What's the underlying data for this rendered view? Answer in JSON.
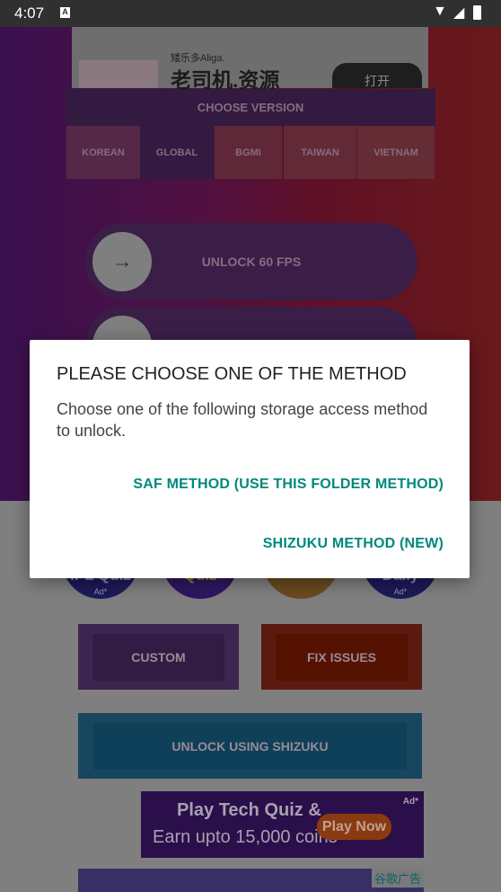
{
  "status": {
    "time": "4:07",
    "notification_icon": "a-icon",
    "icons": [
      "wifi-icon",
      "signal-icon",
      "battery-charging-icon"
    ]
  },
  "top_ad": {
    "subtitle": "矮乐多Aliga.",
    "title": "老司机.资源",
    "button": "打开"
  },
  "version": {
    "header": "CHOOSE VERSION",
    "options": [
      "KOREAN",
      "GLOBAL",
      "BGMI",
      "TAIWAN",
      "VIETNAM"
    ],
    "selected": "GLOBAL"
  },
  "unlock_fps": {
    "label": "UNLOCK 60 FPS",
    "icon": "arrow-right-icon"
  },
  "quiz_ads": [
    {
      "label": "IPL Quiz",
      "badge": "Ad*"
    },
    {
      "label": "Quiz",
      "badge": ""
    },
    {
      "label": "",
      "badge": ""
    },
    {
      "label": "Daily",
      "badge": "Ad*"
    }
  ],
  "buttons": {
    "custom": "CUSTOM",
    "fix": "FIX ISSUES",
    "shizuku": "UNLOCK USING SHIZUKU"
  },
  "banner_ad": {
    "line1": "Play Tech Quiz &",
    "line2": "Earn upto 15,000 coins",
    "cta": "Play Now",
    "badge": "Ad*"
  },
  "bottom_ad": {
    "label": "谷歌广告"
  },
  "dialog": {
    "title": "PLEASE CHOOSE ONE OF THE METHOD",
    "message": "Choose one of the following storage access method to unlock.",
    "option1": "SAF METHOD (USE THIS FOLDER METHOD)",
    "option2": "SHIZUKU METHOD (NEW)"
  },
  "colors": {
    "accent": "#00897b",
    "custom": "#3a2048",
    "fix": "#5a1a10",
    "shizuku": "#17465e"
  }
}
